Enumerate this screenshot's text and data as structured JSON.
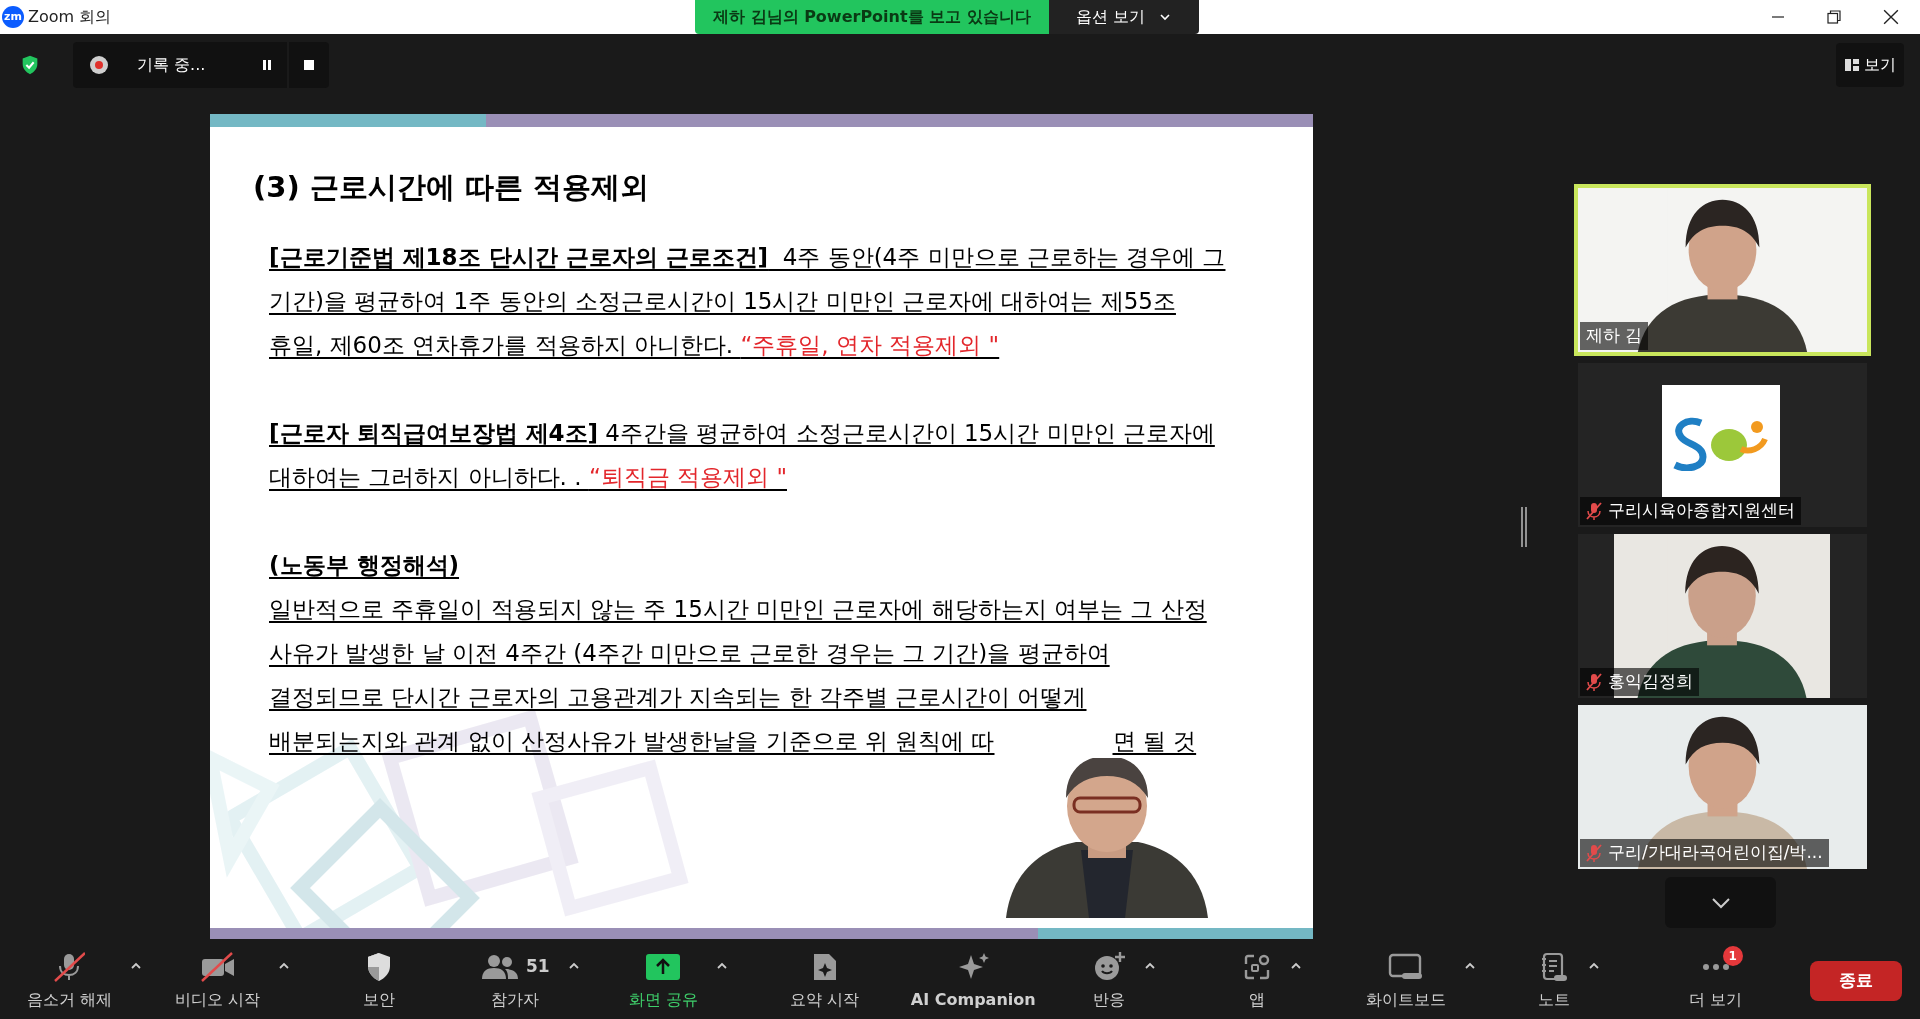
{
  "window": {
    "app_badge": "zm",
    "title": "Zoom 회의"
  },
  "share_banner": {
    "text": "제하 김님의 PowerPoint를 보고 있습니다",
    "options": "옵션 보기"
  },
  "recording": {
    "label": "기록 중..."
  },
  "view_button": "보기",
  "slide": {
    "title": "(3) 근로시간에 따른 적용제외",
    "blocks": [
      {
        "lines": [
          {
            "segments": [
              {
                "kind": "bold",
                "text": "[근로기준법 제18조 단시간 근로자의 근로조건]"
              },
              {
                "kind": "plain",
                "text": "  4주 동안(4주 미만으로 근로하는 경우에 그"
              }
            ]
          },
          {
            "segments": [
              {
                "kind": "plain",
                "text": "기간)을 평균하여 1주 동안의 소정근로시간이 15시간 미만인 근로자에 대하여는 제55조"
              }
            ]
          },
          {
            "segments": [
              {
                "kind": "plain",
                "text": "휴일, 제60조 연차휴가를 적용하지 아니한다. "
              },
              {
                "kind": "red",
                "text": "“주휴일, 연차 적용제외 \""
              }
            ]
          }
        ]
      },
      {
        "lines": [
          {
            "segments": [
              {
                "kind": "bold",
                "text": "[근로자 퇴직급여보장법 제4조]"
              },
              {
                "kind": "plain",
                "text": " 4주간을 평균하여 소정근로시간이 15시간 미만인 근로자에"
              }
            ]
          },
          {
            "segments": [
              {
                "kind": "plain",
                "text": "대하여는 그러하지 아니하다. . "
              },
              {
                "kind": "red",
                "text": "“퇴직금 적용제외 \""
              }
            ]
          }
        ]
      },
      {
        "lines": [
          {
            "segments": [
              {
                "kind": "bold",
                "text": "(노동부 행정해석)"
              }
            ]
          },
          {
            "segments": [
              {
                "kind": "plain",
                "text": "일반적으로 주휴일이 적용되지 않는 주 15시간 미만인 근로자에 해당하는지 여부는 그 산정"
              }
            ]
          },
          {
            "segments": [
              {
                "kind": "plain",
                "text": "사유가 발생한 날 이전 4주간 (4주간 미만으로 근로한 경우는 그 기간)을 평균하여"
              }
            ]
          },
          {
            "segments": [
              {
                "kind": "plain",
                "text": "결정되므로 단시간 근로자의 고용관계가 지속되는 한 각주별 근로시간이 어떻게"
              }
            ]
          },
          {
            "covered": true,
            "segments": [
              {
                "kind": "plain",
                "text": "배분되는지와 관계 없이 산정사유가 발생한날을 기준으로 위 원칙에 따"
              },
              {
                "kind": "plain",
                "text": "면 될 것"
              }
            ]
          }
        ]
      }
    ]
  },
  "participants": [
    {
      "name": "제하 김",
      "kind": "video",
      "muted": false,
      "speaking": true
    },
    {
      "name": "구리시육아종합지원센터",
      "kind": "logo",
      "muted": true,
      "speaking": false
    },
    {
      "name": "홍익김정희",
      "kind": "video_narrow",
      "muted": true,
      "speaking": false
    },
    {
      "name": "구리/가대라곡어린이집/박...",
      "kind": "video",
      "muted": true,
      "speaking": false
    }
  ],
  "toolbar": [
    {
      "kind": "mic",
      "label": "음소거 해제",
      "off": true,
      "caret": true,
      "highlight": false
    },
    {
      "kind": "video",
      "label": "비디오 시작",
      "off": true,
      "caret": true,
      "highlight": false
    },
    {
      "kind": "shield",
      "label": "보안",
      "off": false,
      "caret": false,
      "highlight": false
    },
    {
      "kind": "people",
      "label": "참가자",
      "count": "51",
      "off": false,
      "caret": true,
      "highlight": false
    },
    {
      "kind": "share",
      "label": "화면 공유",
      "off": false,
      "caret": true,
      "highlight": true
    },
    {
      "kind": "summary",
      "label": "요약 시작",
      "off": false,
      "caret": false,
      "highlight": false
    },
    {
      "kind": "sparkle",
      "label": "AI Companion",
      "off": false,
      "caret": false,
      "highlight": false,
      "bold": true
    },
    {
      "kind": "smile",
      "label": "반응",
      "off": false,
      "caret": true,
      "highlight": false
    },
    {
      "kind": "apps",
      "label": "앱",
      "off": false,
      "caret": true,
      "highlight": false
    },
    {
      "kind": "whiteboard",
      "label": "화이트보드",
      "off": false,
      "caret": true,
      "highlight": false
    },
    {
      "kind": "notes",
      "label": "노트",
      "off": false,
      "caret": true,
      "highlight": false
    },
    {
      "kind": "more",
      "label": "더 보기",
      "badge": "1",
      "off": false,
      "caret": false,
      "highlight": false
    }
  ],
  "end_button": "종료"
}
